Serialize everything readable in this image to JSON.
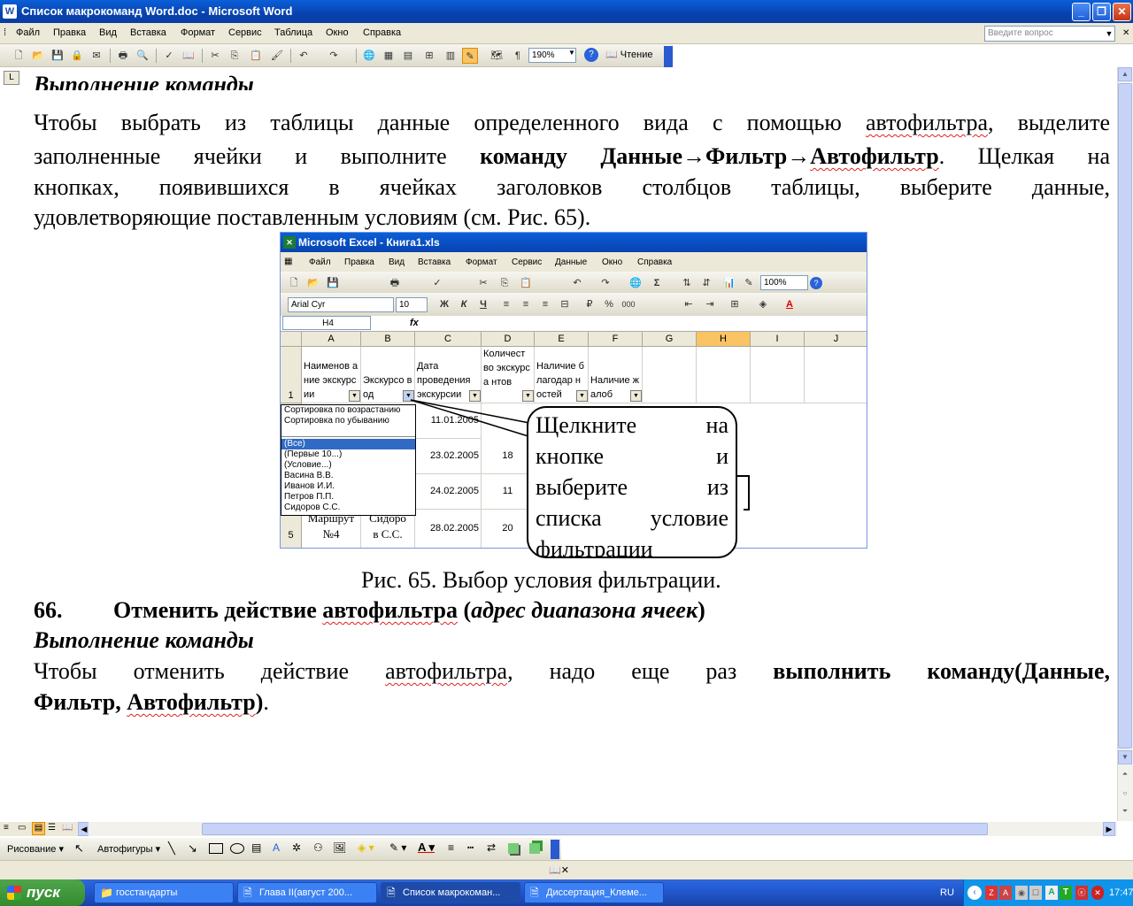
{
  "window": {
    "title": "Список макрокоманд Word.doc - Microsoft Word",
    "app_icon": "W"
  },
  "menu": [
    "Файл",
    "Правка",
    "Вид",
    "Вставка",
    "Формат",
    "Сервис",
    "Таблица",
    "Окно",
    "Справка"
  ],
  "ask_placeholder": "Введите вопрос",
  "toolbar": {
    "zoom": "190%",
    "reading_label": "Чтение"
  },
  "ruler_corner": "L",
  "document": {
    "heading_top": "Выполнение команды",
    "para1_a": "Чтобы выбрать из таблицы данные определенного вида с помощью ",
    "para1_b": "автофильтра",
    "para1_c": ", выделите",
    "para2_a": "заполненные ячейки и выполните ",
    "para2_b": "команду Данные→Фильтр→",
    "para2_c": "Автофильтр",
    "para2_d": ". Щелкая на",
    "para3": "кнопках, появившихся в ячейках заголовков столбцов таблицы, выберите данные,",
    "para4": "удовлетворяющие поставленным условиям (см. Рис. 65).",
    "caption": "Рис. 65. Выбор условия фильтрации.",
    "item_number": "66.",
    "item_a": "Отменить действие ",
    "item_b": "автофильтра",
    "item_c": " (",
    "item_d": "адрес диапазона ячеек",
    "item_e": ")",
    "heading2": "Выполнение команды",
    "para5_a": "Чтобы отменить действие ",
    "para5_b": "автофильтра",
    "para5_c": ", надо еще раз ",
    "para5_d": "выполнить команду(Данные,",
    "para6_a": "Фильтр, ",
    "para6_b": "Автофильтр",
    "para6_c": ")",
    "para6_d": "."
  },
  "excel": {
    "title": "Microsoft Excel - Книга1.xls",
    "menu": [
      "Файл",
      "Правка",
      "Вид",
      "Вставка",
      "Формат",
      "Сервис",
      "Данные",
      "Окно",
      "Справка"
    ],
    "zoom": "100%",
    "font": "Arial Cyr",
    "font_size": "10",
    "namebox": "H4",
    "fx": "fx",
    "columns": [
      "A",
      "B",
      "C",
      "D",
      "E",
      "F",
      "G",
      "H",
      "I",
      "J"
    ],
    "rows": [
      "1",
      "2",
      "3",
      "4",
      "5"
    ],
    "headers": [
      "Наименов ание экскурсии",
      "Экскурсо вод",
      "Дата проведения экскурсии",
      "Количест во экскурса нтов",
      "Наличие благодар ностей",
      "Наличие жалоб"
    ],
    "dates": [
      "11.01.2005",
      "23.02.2005",
      "24.02.2005",
      "28.02.2005"
    ],
    "counts": [
      "",
      "18",
      "11",
      "20"
    ],
    "row5": {
      "a1": "Маршрут",
      "a2": "№4",
      "b1": "Сидоро",
      "b2": "в С.С."
    },
    "dropdown": [
      "Сортировка по возрастанию",
      "Сортировка по убыванию",
      "",
      "(Все)",
      "(Первые 10...)",
      "(Условие...)",
      "Васина В.В.",
      "Иванов И.И.",
      "Петров П.П.",
      "Сидоров С.С."
    ],
    "callout": [
      "Щелкните на",
      "кнопке и",
      "выберите из",
      "списка условие",
      "фильтрации"
    ]
  },
  "drawing": {
    "draw_label": "Рисование",
    "autoshapes_label": "Автофигуры"
  },
  "taskbar": {
    "start": "пуск",
    "tasks": [
      "госстандарты",
      "Глава II(август 200...",
      "Список макрокоман...",
      "Диссертация_Клеме..."
    ],
    "lang": "RU",
    "clock": "17:47"
  }
}
